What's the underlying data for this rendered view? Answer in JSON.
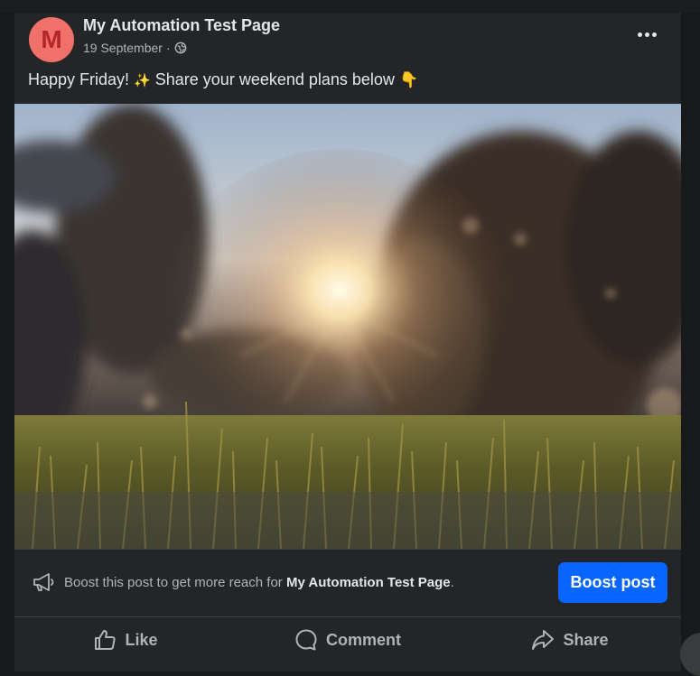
{
  "post": {
    "avatar_letter": "M",
    "page_name": "My Automation Test Page",
    "date": "19 September",
    "separator": "·",
    "text_before": "Happy Friday!",
    "sparkle_emoji": "✨",
    "text_after": "Share your weekend plans below",
    "pointing_emoji": "👇"
  },
  "boost": {
    "text_prefix": "Boost this post to get more reach for ",
    "page_name": "My Automation Test Page",
    "text_suffix": ".",
    "button_label": "Boost post"
  },
  "actions": {
    "like": "Like",
    "comment": "Comment",
    "share": "Share"
  },
  "colors": {
    "background": "#18191a",
    "card": "#242526",
    "primary_text": "#e4e6eb",
    "secondary_text": "#b0b3b8",
    "accent": "#0866ff",
    "avatar": "#f0716a"
  },
  "icons": {
    "globe": "globe-icon",
    "more": "more-options-icon",
    "megaphone": "megaphone-icon",
    "like": "thumbs-up-icon",
    "comment": "comment-bubble-icon",
    "share": "share-arrow-icon"
  }
}
